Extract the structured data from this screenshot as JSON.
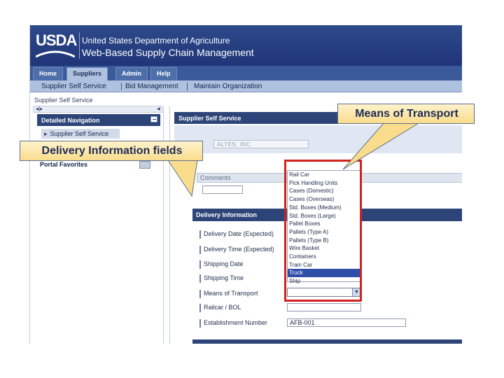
{
  "banner": {
    "logo_text": "USDA",
    "org_name": "United States Department of Agriculture",
    "app_name": "Web-Based Supply Chain Management"
  },
  "top_tabs": [
    {
      "label": "Home",
      "active": false
    },
    {
      "label": "Suppliers",
      "active": true
    },
    {
      "label": "Admin",
      "active": false
    },
    {
      "label": "Help",
      "active": false
    }
  ],
  "sub_nav": [
    "Supplier Self Service",
    "Bid Management",
    "Maintain Organization"
  ],
  "breadcrumb": "Supplier Self Service",
  "left_nav": {
    "title": "Detailed Navigation",
    "item": "Supplier Self Service",
    "portal_favorites": "Portal Favorites"
  },
  "main": {
    "header": "Supplier Self Service",
    "company_value": "ALTES, INC.",
    "comments_label": "Comments",
    "delivery_header": "Delivery Information",
    "fields": {
      "delivery_date": "Delivery Date (Expected)",
      "delivery_time": "Delivery Time (Expected)",
      "shipping_date": "Shipping Date",
      "shipping_time": "Shipping Time",
      "means_of_transport": "Means of Transport",
      "railcar_bol": "Railcar / BOL",
      "establishment_number": "Establishment Number"
    },
    "establishment_value": "AFB-001"
  },
  "dropdown": {
    "options": [
      "Rail Car",
      "Pick Handling Units",
      "Cases (Domestic)",
      "Cases (Overseas)",
      "Std. Boxes (Medium)",
      "Std. Boxes (Large)",
      "Pallet Boxes",
      "Pallets (Type A)",
      "Pallets (Type B)",
      "Wire Basket",
      "Containers",
      "Train Car",
      "Truck",
      "Ship"
    ],
    "selected": "Truck"
  },
  "callouts": {
    "means_of_transport": "Means of Transport",
    "delivery_information": "Delivery Information fields"
  },
  "colors": {
    "banner": "#1f3577",
    "nav_header": "#2c4478",
    "highlight": "#d3231f",
    "callout": "#f9dc8c",
    "selected_option": "#2f4ea7"
  }
}
